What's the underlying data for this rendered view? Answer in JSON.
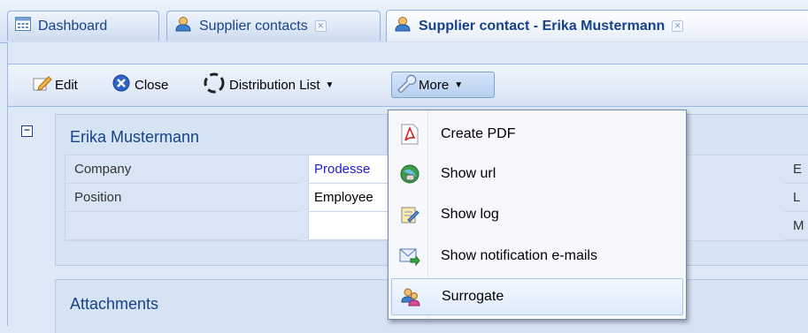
{
  "tabs": [
    {
      "label": "Dashboard",
      "icon": "dashboard-icon"
    },
    {
      "label": "Supplier contacts",
      "icon": "user-icon",
      "closable": true
    },
    {
      "label": "Supplier contact - Erika Mustermann",
      "icon": "user-icon",
      "closable": true,
      "active": true
    }
  ],
  "toolbar": {
    "edit_label": "Edit",
    "close_label": "Close",
    "distribution_label": "Distribution List",
    "more_label": "More"
  },
  "contact": {
    "name": "Erika Mustermann",
    "rows": [
      {
        "label": "Company",
        "value": "Prodesse",
        "right": "E"
      },
      {
        "label": "Position",
        "value": "Employee",
        "right": "L"
      },
      {
        "label": "",
        "value": "",
        "right": "M"
      }
    ]
  },
  "attachments": {
    "title": "Attachments"
  },
  "more_menu": {
    "items": [
      {
        "label": "Create PDF",
        "icon": "pdf-icon"
      },
      {
        "label": "Show url",
        "icon": "globe-link-icon"
      },
      {
        "label": "Show log",
        "icon": "log-notepad-icon"
      },
      {
        "label": "Show notification e-mails",
        "icon": "mail-arrow-icon"
      },
      {
        "label": "Surrogate",
        "icon": "surrogate-users-icon"
      }
    ]
  },
  "colors": {
    "accent": "#15428b",
    "link": "#1d1dd2",
    "background": "#dfe8f6"
  }
}
